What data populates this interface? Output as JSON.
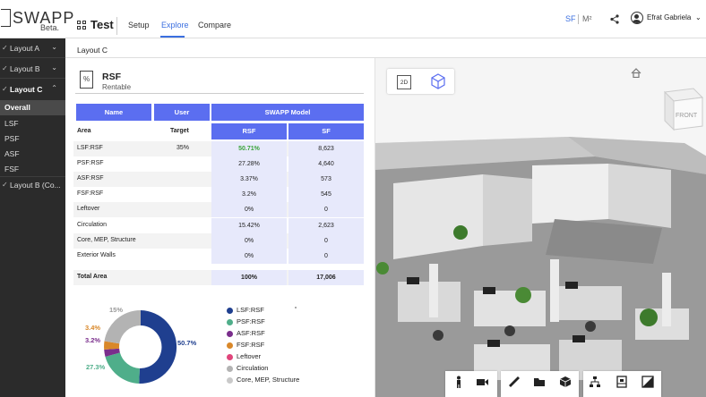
{
  "app": {
    "logo_text": "SWAPP",
    "logo_beta": "Beta.",
    "project_name": "Test",
    "tabs": [
      "Setup",
      "Explore",
      "Compare"
    ],
    "active_tab": "Explore",
    "unit_sf": "SF",
    "unit_m2": "M²",
    "user_name": "Efrat Gabriela"
  },
  "sidebar": {
    "items": [
      {
        "label": "Layout A",
        "expanded": false
      },
      {
        "label": "Layout B",
        "expanded": false
      },
      {
        "label": "Layout C",
        "expanded": true
      }
    ],
    "subitems": [
      "Overall",
      "LSF",
      "PSF",
      "ASF",
      "FSF"
    ],
    "selected": "Overall",
    "last_item": "Layout B (Co..."
  },
  "main": {
    "layout_title": "Layout C",
    "section_title": "RSF",
    "section_subtitle": "Rentable",
    "rsf_icon_text": "%",
    "table": {
      "headers": {
        "name": "Name",
        "user_requirement": "User Requirement",
        "swapp_model": "SWAPP Model"
      },
      "subheaders": {
        "area": "Area",
        "target": "Target",
        "rsf": "RSF",
        "sf": "SF"
      },
      "rows": [
        {
          "name": "LSF:RSF",
          "target": "35%",
          "rsf": "50.71%",
          "sf": "8,623"
        },
        {
          "name": "PSF:RSF",
          "target": "",
          "rsf": "27.28%",
          "sf": "4,640"
        },
        {
          "name": "ASF:RSF",
          "target": "",
          "rsf": "3.37%",
          "sf": "573"
        },
        {
          "name": "FSF:RSF",
          "target": "",
          "rsf": "3.2%",
          "sf": "545"
        },
        {
          "name": "Leftover",
          "target": "",
          "rsf": "0%",
          "sf": "0"
        },
        {
          "name": "Circulation",
          "target": "",
          "rsf": "15.42%",
          "sf": "2,623"
        },
        {
          "name": "Core, MEP, Structure",
          "target": "",
          "rsf": "0%",
          "sf": "0"
        },
        {
          "name": "Exterior Walls",
          "target": "",
          "rsf": "0%",
          "sf": "0"
        }
      ],
      "total": {
        "name": "Total Area",
        "rsf": "100%",
        "sf": "17,006"
      }
    },
    "donut_labels": {
      "lsf": "50.7%",
      "psf": "27.3%",
      "asf": "3.2%",
      "fsf": "3.4%",
      "circ": "15%"
    },
    "legend": [
      "LSF:RSF",
      "PSF:RSF",
      "ASF:RSF",
      "FSF:RSF",
      "Leftover",
      "Circulation",
      "Core, MEP, Structure"
    ],
    "colors": {
      "lsf": "#1f3f8f",
      "psf": "#4fae8a",
      "asf": "#7a2e8c",
      "fsf": "#d9882a",
      "leftover": "#e0457b",
      "circulation": "#b3b3b3",
      "core": "#c9c9c9",
      "accent": "#5b6ef0"
    }
  },
  "view3d": {
    "toggle_2d": "2D",
    "cube_label": "FRONT"
  }
}
